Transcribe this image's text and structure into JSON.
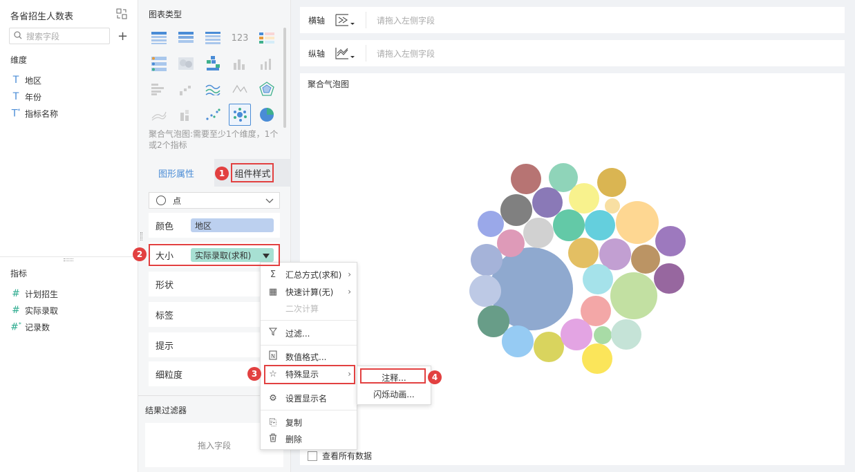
{
  "left_panel": {
    "title": "各省招生人数表",
    "search_placeholder": "搜索字段",
    "dimensions_label": "维度",
    "dimensions": [
      {
        "icon": "T",
        "label": "地区"
      },
      {
        "icon": "T",
        "label": "年份"
      },
      {
        "icon": "T*",
        "label": "指标名称"
      }
    ],
    "metrics_label": "指标",
    "metrics": [
      {
        "icon": "#",
        "label": "计划招生"
      },
      {
        "icon": "#",
        "label": "实际录取"
      },
      {
        "icon": "#*",
        "label": "记录数"
      }
    ]
  },
  "middle_panel": {
    "chart_type_label": "图表类型",
    "chart_hint": "聚合气泡图:需要至少1个维度，1个或2个指标",
    "tab_graph": "图形属性",
    "tab_component": "组件样式",
    "mark_type": "点",
    "props": {
      "color": "颜色",
      "color_field": "地区",
      "size": "大小",
      "size_field": "实际录取(求和)",
      "shape": "形状",
      "label": "标签",
      "tooltip": "提示",
      "granularity": "细粒度"
    },
    "result_filter": "结果过滤器",
    "drop_hint": "拖入字段"
  },
  "right_panel": {
    "x_axis": "横轴",
    "y_axis": "纵轴",
    "axis_hint": "请拖入左侧字段",
    "chart_title": "聚合气泡图",
    "view_all": "查看所有数据"
  },
  "context_menu": {
    "items": [
      "汇总方式(求和)",
      "快速计算(无)",
      "二次计算",
      "过滤...",
      "数值格式...",
      "特殊显示",
      "设置显示名",
      "复制",
      "删除"
    ]
  },
  "submenu": {
    "items": [
      "注释...",
      "闪烁动画..."
    ]
  },
  "badges": [
    "1",
    "2",
    "3",
    "4"
  ],
  "colors": {
    "accent": "#4a8cd6",
    "highlight": "#e24040",
    "big_bubble": "#8fa9cf"
  }
}
